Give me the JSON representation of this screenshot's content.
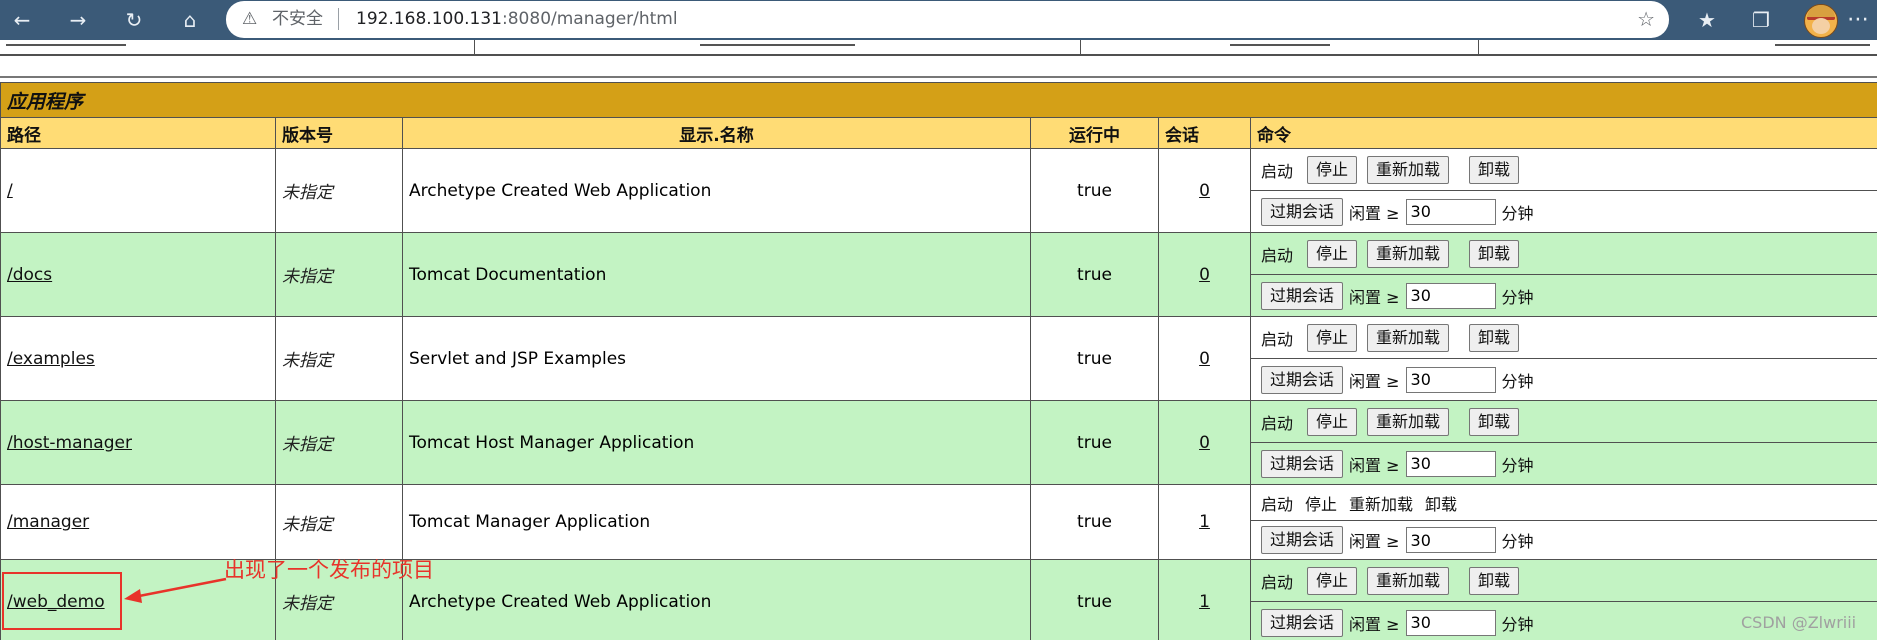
{
  "browser": {
    "security_label": "不安全",
    "url_host": "192.168.100.131",
    "url_rest": ":8080/manager/html"
  },
  "apps_section": {
    "title": "应用程序",
    "columns": [
      "路径",
      "版本号",
      "显示.名称",
      "运行中",
      "会话",
      "命令"
    ],
    "rows": [
      {
        "path": "/",
        "version": "未指定",
        "display_name": "Archetype Created Web Application",
        "running": "true",
        "sessions": "0",
        "controls": "buttons"
      },
      {
        "path": "/docs",
        "version": "未指定",
        "display_name": "Tomcat Documentation",
        "running": "true",
        "sessions": "0",
        "controls": "buttons"
      },
      {
        "path": "/examples",
        "version": "未指定",
        "display_name": "Servlet and JSP Examples",
        "running": "true",
        "sessions": "0",
        "controls": "buttons"
      },
      {
        "path": "/host-manager",
        "version": "未指定",
        "display_name": "Tomcat Host Manager Application",
        "running": "true",
        "sessions": "0",
        "controls": "buttons"
      },
      {
        "path": "/manager",
        "version": "未指定",
        "display_name": "Tomcat Manager Application",
        "running": "true",
        "sessions": "1",
        "controls": "text"
      },
      {
        "path": "/web_demo",
        "version": "未指定",
        "display_name": "Archetype Created Web Application",
        "running": "true",
        "sessions": "1",
        "controls": "buttons"
      }
    ],
    "commands": {
      "start": "启动",
      "stop": "停止",
      "reload": "重新加载",
      "undeploy": "卸载",
      "expire": "过期会话",
      "idle_label": "闲置 ≥",
      "idle_value": "30",
      "minutes": "分钟"
    }
  },
  "annotation": {
    "text": "出现了一个发布的项目",
    "color": "#e8332a"
  },
  "watermark": "CSDN @Zlwriii",
  "colors": {
    "title_bg": "#d4a017",
    "header_bg": "#ffdc75",
    "row_green": "#c3f3c3",
    "chrome_bg": "#3b5a78"
  }
}
